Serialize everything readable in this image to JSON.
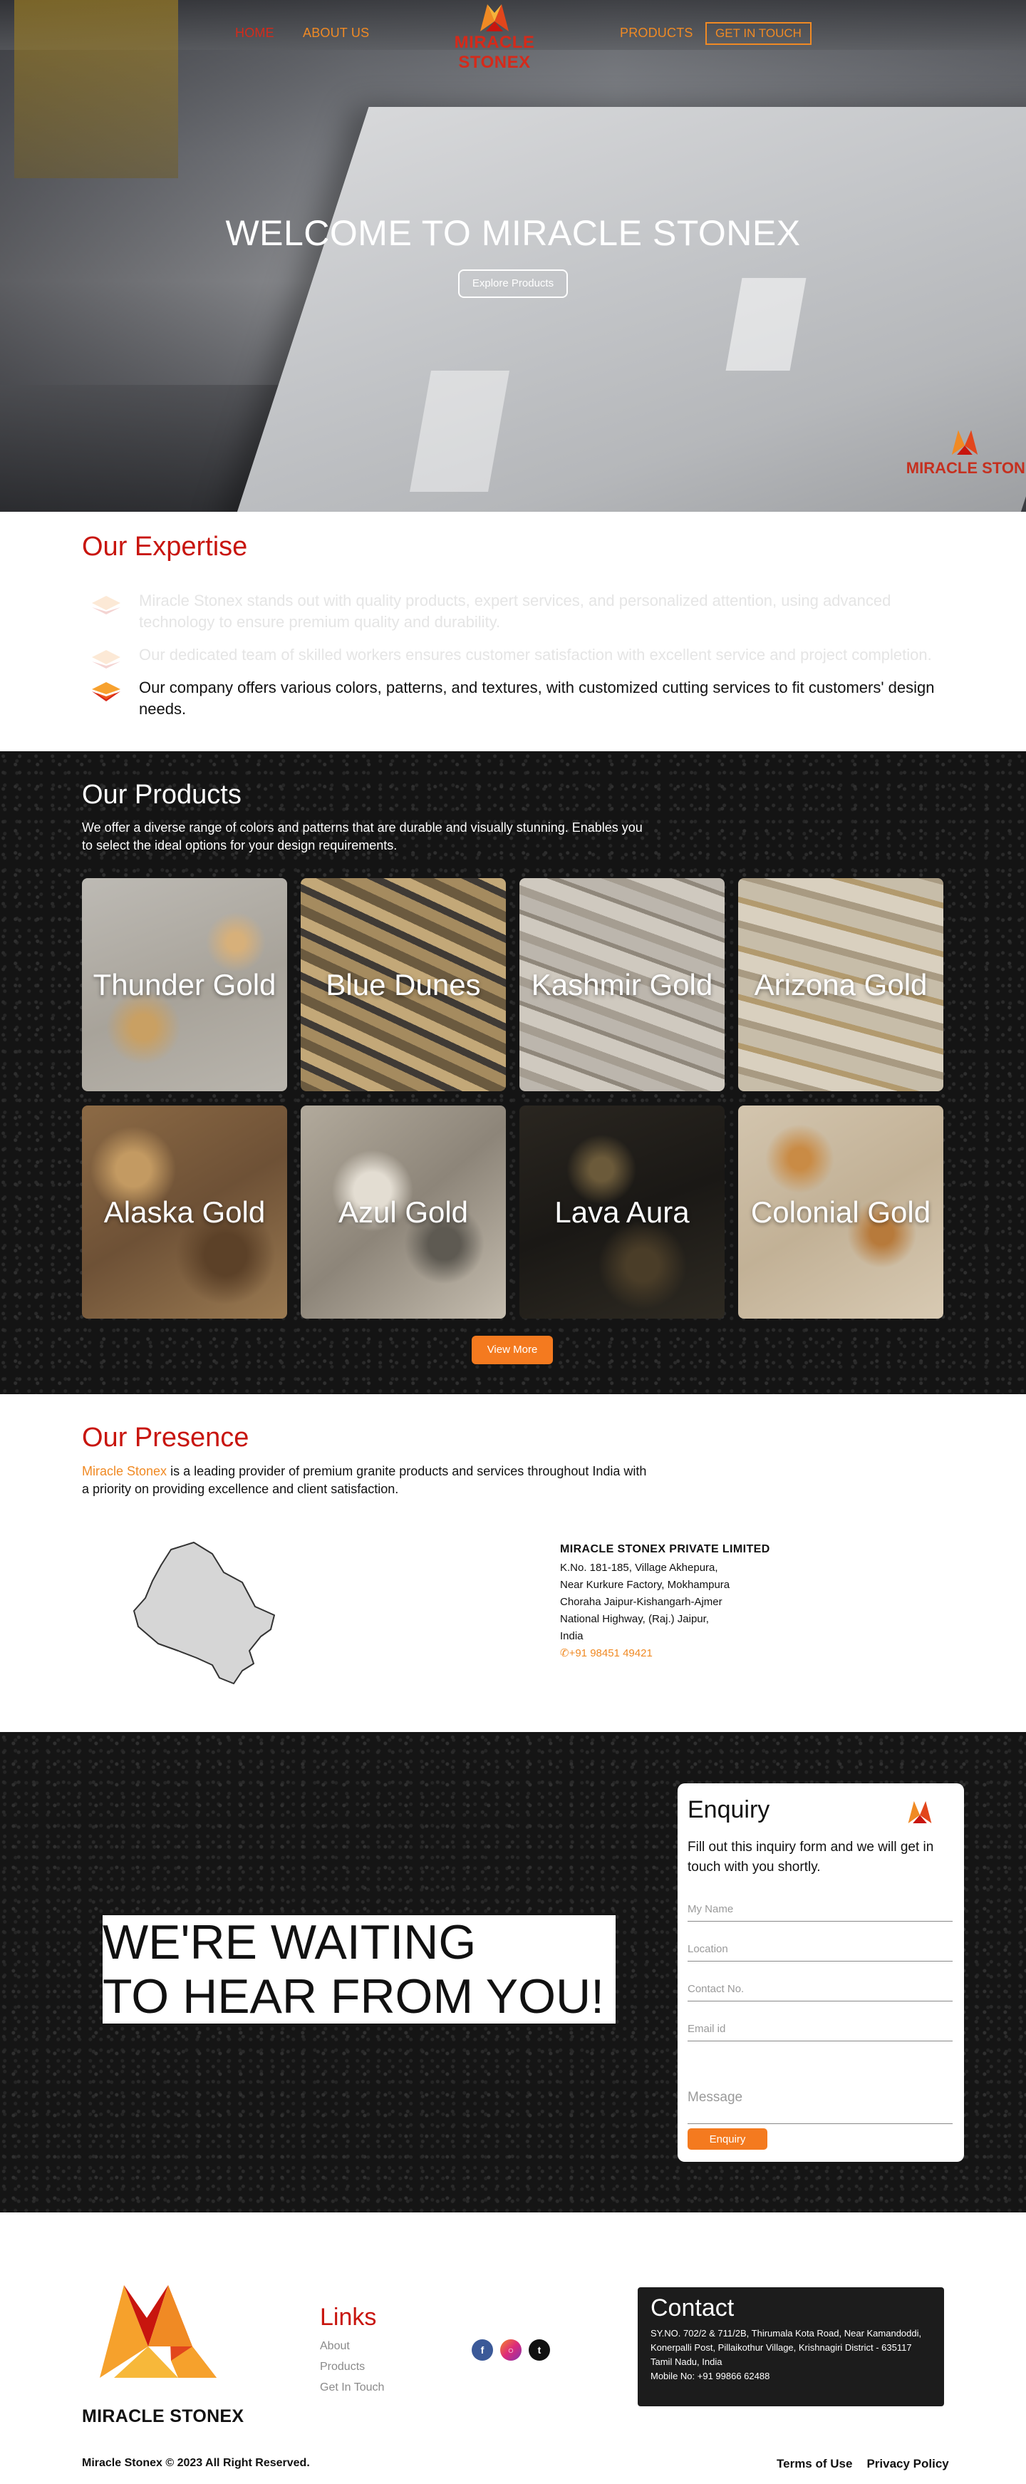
{
  "brand": {
    "name": "MIRACLE STONEX",
    "accent": "#f08a24",
    "red": "#c8150e"
  },
  "nav": {
    "home": "HOME",
    "about": "ABOUT US",
    "products": "PRODUCTS",
    "contact": "GET IN TOUCH"
  },
  "hero": {
    "title": "WELCOME TO MIRACLE STONEX",
    "button": "Explore Products",
    "watermark": "MIRACLE STONEX"
  },
  "expertise": {
    "title": "Our Expertise",
    "items": [
      "Miracle Stonex stands out with quality products, expert services, and personalized attention, using advanced technology to ensure premium quality and durability.",
      "Our dedicated team of skilled workers ensures customer satisfaction with excellent service and project completion.",
      "Our company offers various colors, patterns, and textures, with customized cutting services to fit customers' design needs."
    ]
  },
  "products": {
    "title": "Our Products",
    "description": "We offer a diverse range of colors and patterns that are durable and visually stunning. Enables you to select the ideal options for your design requirements.",
    "items": [
      "Thunder Gold",
      "Blue Dunes",
      "Kashmir Gold",
      "Arizona Gold",
      "Alaska Gold",
      "Azul Gold",
      "Lava Aura",
      "Colonial Gold"
    ],
    "view_more": "View More"
  },
  "presence": {
    "title": "Our Presence",
    "highlight": "Miracle Stonex",
    "description": " is a leading provider of premium granite products and services throughout India with a priority on providing excellence and client satisfaction.",
    "company": "MIRACLE STONEX PRIVATE LIMITED",
    "address": [
      "K.No. 181-185, Village Akhepura,",
      "Near Kurkure Factory, Mokhampura",
      "Choraha Jaipur-Kishangarh-Ajmer",
      "National Highway, (Raj.) Jaipur,",
      "India"
    ],
    "phone": "+91 98451 49421"
  },
  "enquiry": {
    "heading_line1": "WE'RE WAITING",
    "heading_line2": "TO HEAR FROM YOU!",
    "title": "Enquiry",
    "description": "Fill out this inquiry form and we will get in touch with you shortly.",
    "placeholders": {
      "name": "My Name",
      "location": "Location",
      "contact": "Contact No.",
      "email": "Email id",
      "message": "Message"
    },
    "button": "Enquiry"
  },
  "footer": {
    "brand": "MIRACLE STONEX",
    "links_title": "Links",
    "links": [
      "About",
      "Products",
      "Get In Touch"
    ],
    "contact_title": "Contact",
    "contact_lines": [
      "SY.NO. 702/2 & 711/2B, Thirumala Kota Road, Near Kamandoddi,",
      "Konerpalli Post, Pillaikothur Village, Krishnagiri District - 635117",
      "Tamil Nadu, India",
      "Mobile No: +91 99866 62488"
    ],
    "copyright": "Miracle Stonex © 2023 All Right Reserved.",
    "terms": "Terms of Use",
    "privacy": "Privacy Policy",
    "socials": [
      "facebook-icon",
      "instagram-icon",
      "twitter-icon"
    ]
  }
}
